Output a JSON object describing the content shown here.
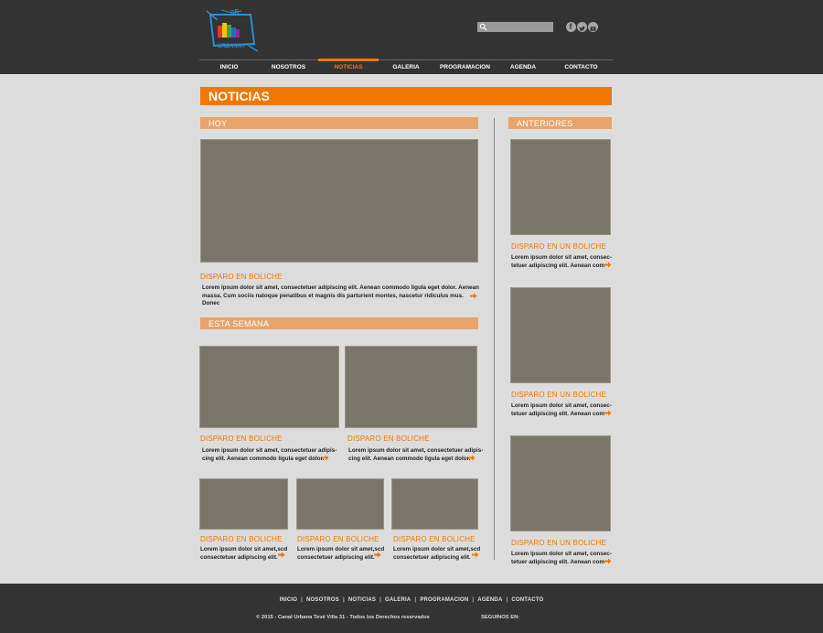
{
  "header": {
    "logo_text": "URBANA",
    "logo_badge": "=5",
    "logo_sub": "tv",
    "search": {
      "value": "",
      "placeholder": ""
    },
    "social": [
      "facebook-icon",
      "twitter-icon",
      "youtube-icon"
    ]
  },
  "nav": {
    "items": [
      {
        "label": "INICIO",
        "active": false
      },
      {
        "label": "NOSOTROS",
        "active": false
      },
      {
        "label": "NOTICIAS",
        "active": true
      },
      {
        "label": "GALERIA",
        "active": false
      },
      {
        "label": "PROGRAMACION",
        "active": false
      },
      {
        "label": "AGENDA",
        "active": false
      },
      {
        "label": "CONTACTO",
        "active": false
      }
    ]
  },
  "page": {
    "title": "NOTICIAS"
  },
  "sections": {
    "hoy": "HOY",
    "semana": "ESTA SEMANA",
    "anteriores": "ANTERIORES"
  },
  "hoy_article": {
    "headline": "DISPARO EN BOLICHE",
    "text_line1": "Lorem ipsum dolor sit amet, consectetuer adipiscing elit. Aenean commodo ligula eget dolor. Aenean",
    "text_line2": "massa. Cum sociis natoque penatibus et magnis dis parturient montes, nascetur ridiculus mus. Donec"
  },
  "semana_articles": [
    {
      "headline": "DISPARO EN BOLICHE",
      "line1": "Lorem ipsum dolor sit amet, consectetuer adipis-",
      "line2": "cing elit. Aenean commodo ligula eget dolor."
    },
    {
      "headline": "DISPARO EN BOLICHE",
      "line1": "Lorem ipsum dolor sit amet, consectetuer adipis-",
      "line2": "cing elit. Aenean commodo ligula eget dolor."
    }
  ],
  "small_articles": [
    {
      "headline": "DISPARO EN BOLICHE",
      "line1": "Lorem ipsum dolor sit amet,scd",
      "line2": "consectetuer adipiscing elit."
    },
    {
      "headline": "DISPARO EN BOLICHE",
      "line1": "Lorem ipsum dolor sit amet,scd",
      "line2": "consectetuer adipiscing elit."
    },
    {
      "headline": "DISPARO EN BOLICHE",
      "line1": "Lorem ipsum dolor sit amet,scd",
      "line2": "consectetuer adipiscing elit."
    }
  ],
  "anteriores_articles": [
    {
      "headline": "DISPARO EN UN BOLICHE",
      "line1": "Lorem ipsum dolor sit amet, consec-",
      "line2": "tetuer adipiscing elit. Aenean com-"
    },
    {
      "headline": "DISPARO EN UN BOLICHE",
      "line1": "Lorem ipsum dolor sit amet, consec-",
      "line2": "tetuer adipiscing elit. Aenean com-"
    },
    {
      "headline": "DISPARO EN UN BOLICHE",
      "line1": "Lorem ipsum dolor sit amet, consec-",
      "line2": "tetuer adipiscing elit. Aenean com-"
    }
  ],
  "footer": {
    "links": [
      "INICIO",
      "NOSOTROS",
      "NOTICIAS",
      "GALERIA",
      "PROGRAMACION",
      "AGENDA",
      "CONTACTO"
    ],
    "copyright": "© 2015 - Canal Urbana Tevé Villa 31 - Todos los Derechos reservados",
    "follow": "SEGUINOS EN:"
  },
  "colors": {
    "accent": "#f07800",
    "section_bar": "#e9a46b",
    "dark": "#333333",
    "background": "#dcdcdc",
    "image_placeholder": "#7a756b"
  }
}
